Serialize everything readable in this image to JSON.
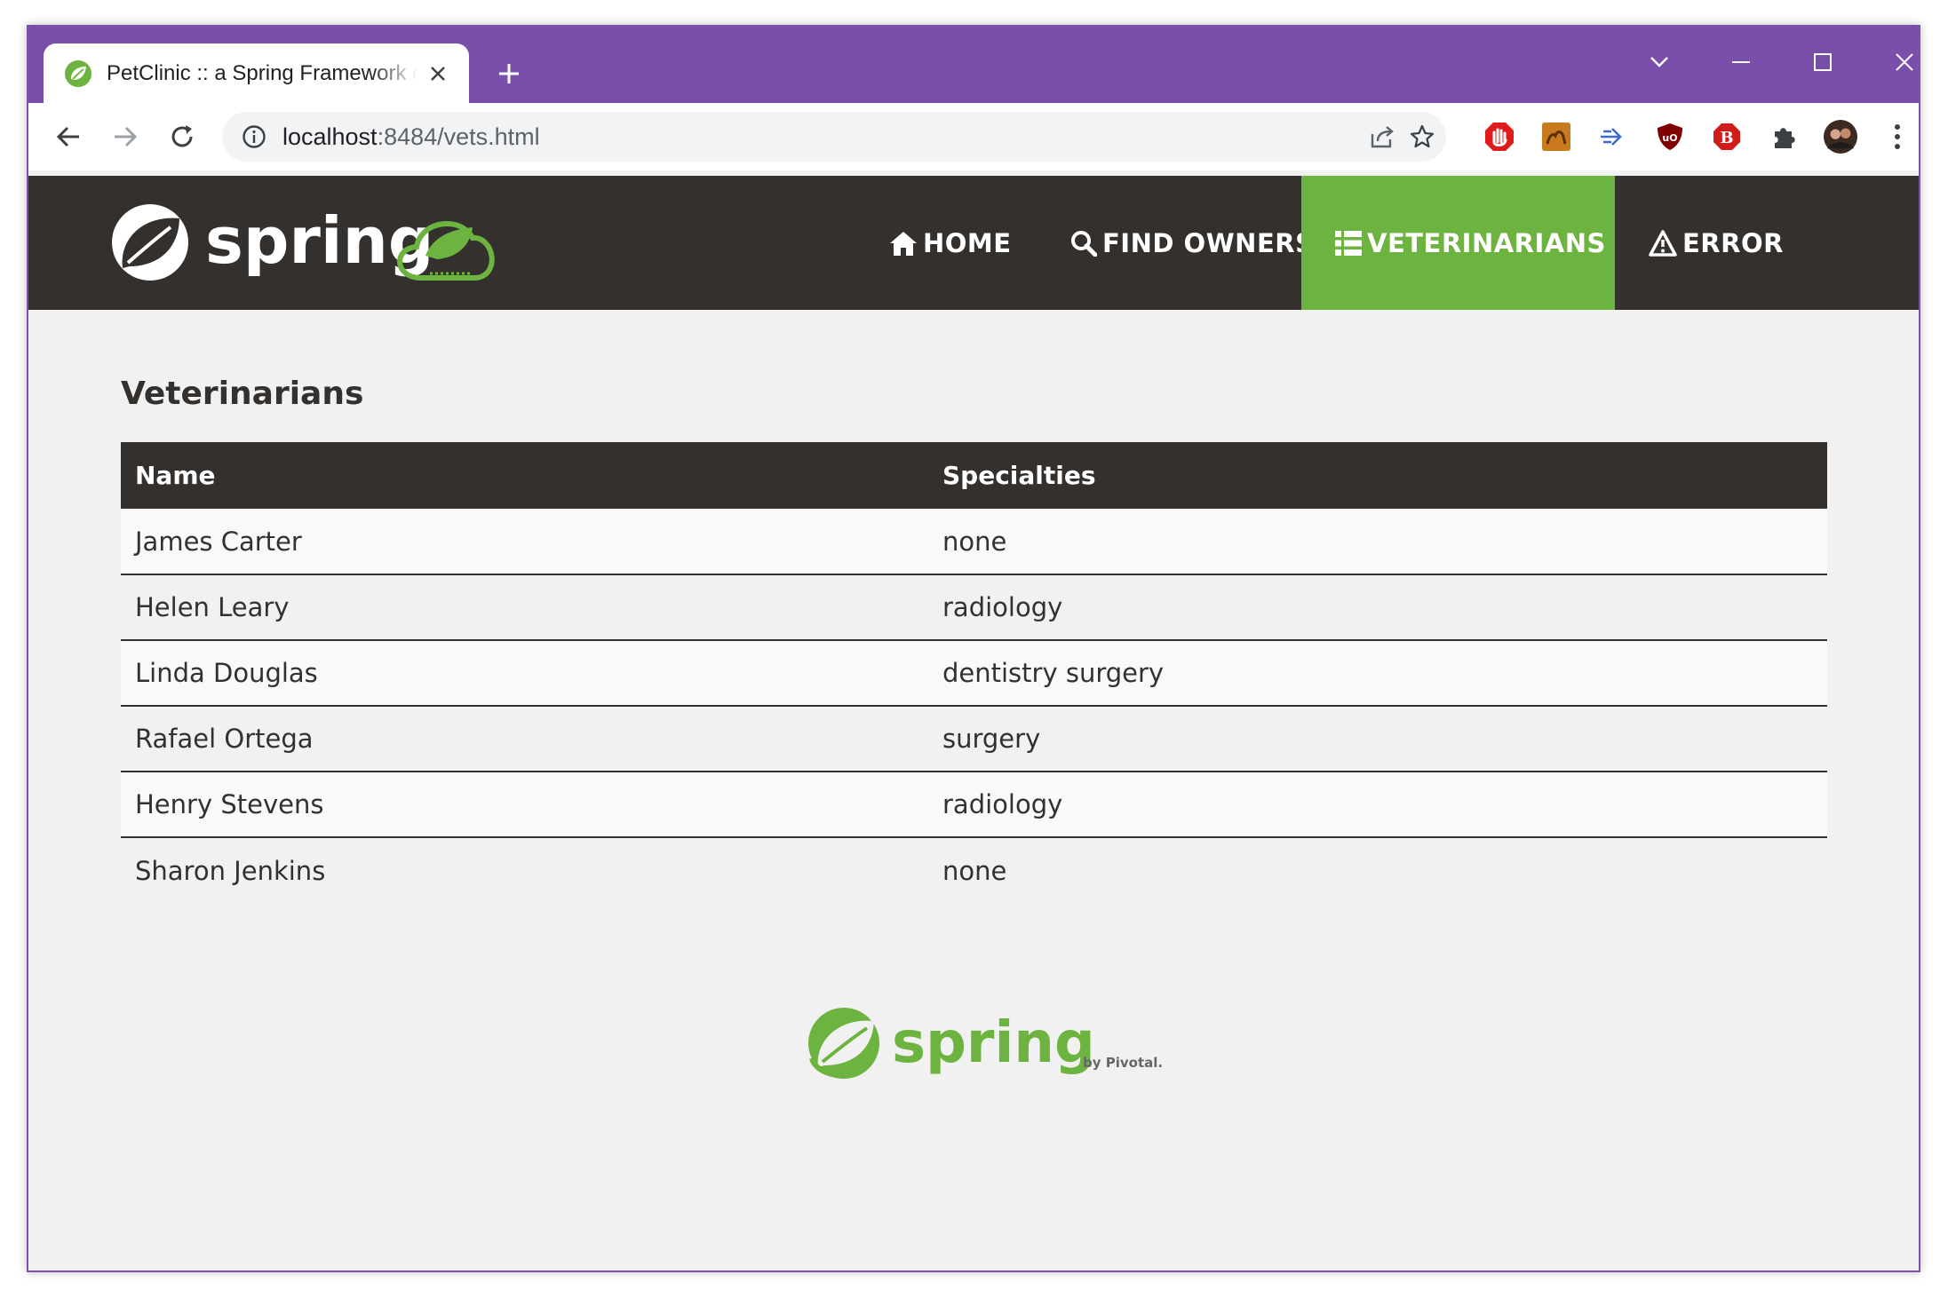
{
  "browser": {
    "tab_title": "PetClinic :: a Spring Framework demonstration",
    "url_host": "localhost",
    "url_rest": ":8484/vets.html",
    "frame_color": "#7a4fac"
  },
  "brand": {
    "logo_text": "spring",
    "accent": "#6db33f",
    "dark": "#34302d"
  },
  "nav": {
    "home": "HOME",
    "find_owners": "FIND OWNERS",
    "veterinarians": "VETERINARIANS",
    "error": "ERROR"
  },
  "page": {
    "title": "Veterinarians",
    "columns": [
      "Name",
      "Specialties"
    ],
    "rows": [
      {
        "name": "James Carter",
        "specialties": "none"
      },
      {
        "name": "Helen Leary",
        "specialties": "radiology"
      },
      {
        "name": "Linda Douglas",
        "specialties": "dentistry surgery"
      },
      {
        "name": "Rafael Ortega",
        "specialties": "surgery"
      },
      {
        "name": "Henry Stevens",
        "specialties": "radiology"
      },
      {
        "name": "Sharon Jenkins",
        "specialties": "none"
      }
    ]
  },
  "footer": {
    "logo_text": "spring",
    "by_text": "by Pivotal."
  }
}
